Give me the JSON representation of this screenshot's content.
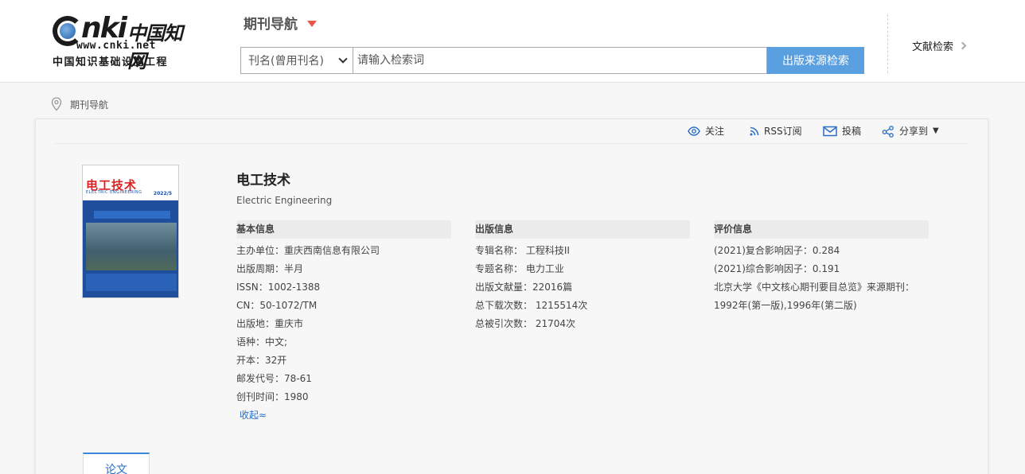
{
  "logo": {
    "brand": "nki",
    "brand_cn": "中国知网",
    "url": "www.cnki.net",
    "subtitle": "中国知识基础设施工程"
  },
  "header": {
    "nav_title": "期刊导航",
    "search": {
      "field_selected": "刊名(曾用刊名)",
      "placeholder": "请输入检索词",
      "button_label": "出版来源检索"
    },
    "lit_search_label": "文献检索"
  },
  "breadcrumb": {
    "label": "期刊导航"
  },
  "toolbar": {
    "follow": "关注",
    "rss": "RSS订阅",
    "submit": "投稿",
    "share": "分享到"
  },
  "cover": {
    "title": "电工技术",
    "subtitle": "ELECTRIC ENGINEERING",
    "issue": "2022/5"
  },
  "journal": {
    "title": "电工技术",
    "title_en": "Electric Engineering"
  },
  "basic_info": {
    "heading": "基本信息",
    "rows": [
      "主办单位：重庆西南信息有限公司",
      "出版周期：半月",
      "ISSN：1002-1388",
      "CN：50-1072/TM",
      "出版地：重庆市",
      "语种：中文;",
      "开本：32开",
      "邮发代号：78-61",
      "创刊时间：1980"
    ],
    "collapse_label": "收起≈"
  },
  "publish_info": {
    "heading": "出版信息",
    "rows": [
      "专辑名称：  工程科技II",
      "专题名称：  电力工业",
      "出版文献量：22016篇",
      "总下载次数：  1215514次",
      "总被引次数：  21704次"
    ]
  },
  "eval_info": {
    "heading": "评价信息",
    "rows": [
      "(2021)复合影响因子：0.284",
      "(2021)综合影响因子：0.191",
      "北京大学《中文核心期刊要目总览》来源期刊：",
      "1992年(第一版),1996年(第二版)"
    ]
  },
  "tabs": {
    "papers": "论文"
  },
  "colors": {
    "accent": "#5a9fe0",
    "link": "#2a6fc6",
    "caret": "#e3574b"
  }
}
